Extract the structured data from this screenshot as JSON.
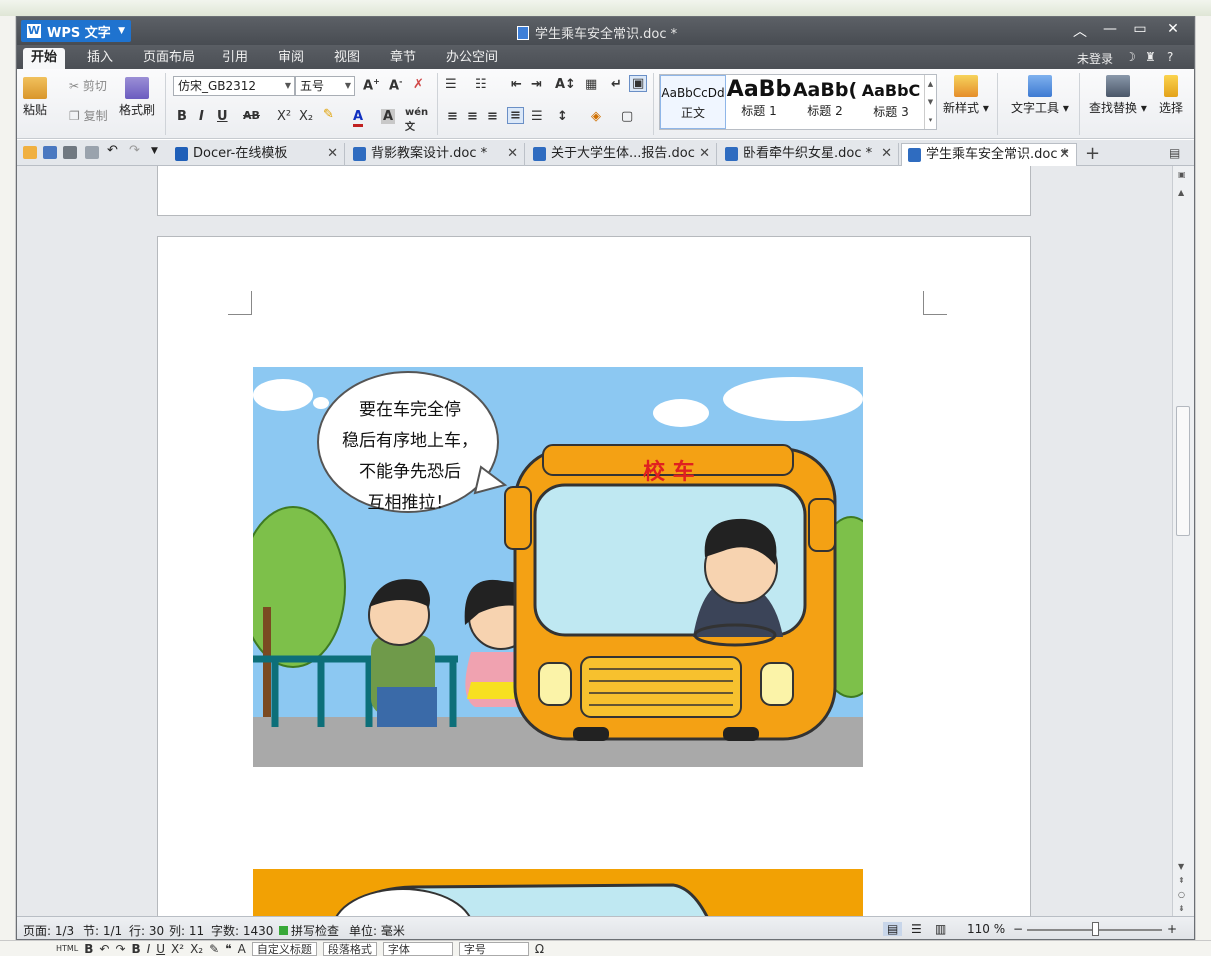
{
  "app": {
    "name": "WPS 文字",
    "window_title": "学生乘车安全常识.doc *"
  },
  "menu_tabs": [
    "开始",
    "插入",
    "页面布局",
    "引用",
    "审阅",
    "视图",
    "章节",
    "办公空间"
  ],
  "menu_right": {
    "login": "未登录",
    "help": "?"
  },
  "ribbon": {
    "paste": "粘贴",
    "cut": "剪切",
    "copy": "复制",
    "format_painter": "格式刷",
    "font_name": "仿宋_GB2312",
    "font_size": "五号",
    "styles": [
      {
        "preview": "AaBbCcDd",
        "name": "正文"
      },
      {
        "preview": "AaBb",
        "name": "标题 1"
      },
      {
        "preview": "AaBb(",
        "name": "标题 2"
      },
      {
        "preview": "AaBbC",
        "name": "标题 3"
      }
    ],
    "new_style": "新样式",
    "text_tools": "文字工具",
    "find_replace": "查找替换",
    "select": "选择"
  },
  "doc_tabs": [
    {
      "label": "Docer-在线模板"
    },
    {
      "label": "背影教案设计.doc *"
    },
    {
      "label": "关于大学生体...报告.doc"
    },
    {
      "label": "卧看牵牛织女星.doc *"
    },
    {
      "label": "学生乘车安全常识.doc *",
      "active": true
    }
  ],
  "document": {
    "bubble_lines": [
      "要在车完全停",
      "稳后有序地上车，",
      "不能争先恐后",
      "互相推拉！"
    ],
    "bus_sign": "校 车"
  },
  "status": {
    "page": "页面: 1/3",
    "section": "节: 1/1",
    "line": "行: 30",
    "col": "列: 11",
    "words": "字数: 1430",
    "spell": "拼写检查",
    "unit": "单位: 毫米",
    "zoom": "110 %"
  },
  "desk_bottom": {
    "custom_heading": "自定义标题",
    "para_format": "段落格式",
    "font": "字体",
    "font_size": "字号"
  },
  "colors": {
    "accent": "#1f73cf",
    "sky": "#8cc8f2",
    "bus": "#f4a114"
  }
}
